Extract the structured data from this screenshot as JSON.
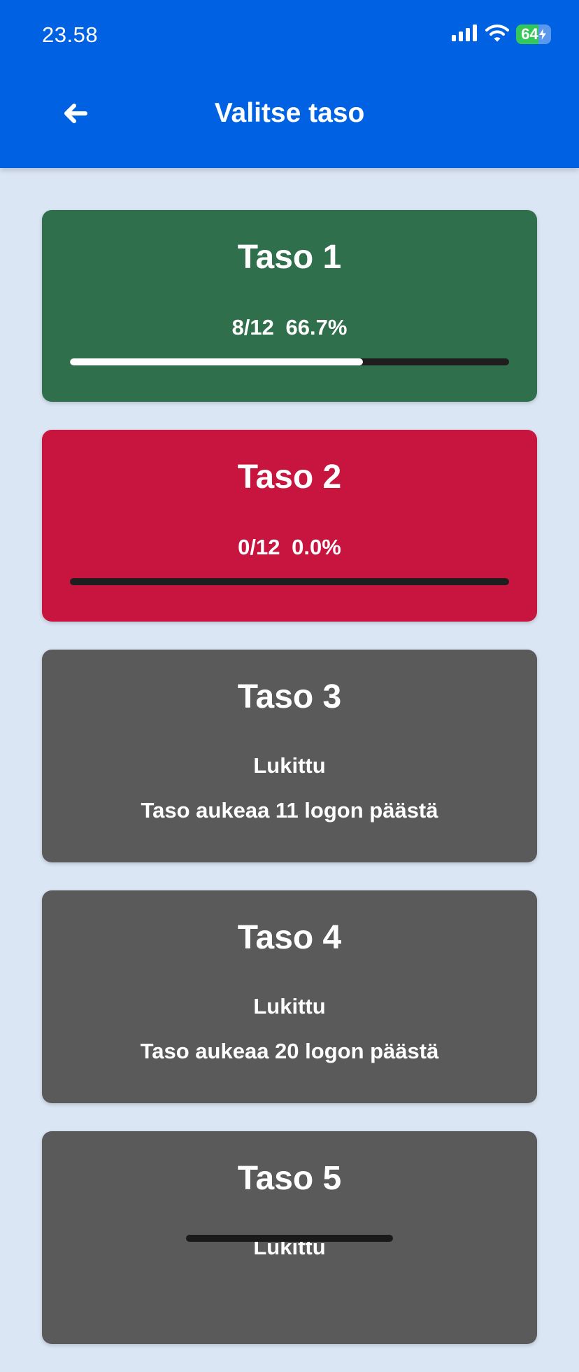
{
  "status_bar": {
    "time": "23.58",
    "battery": "64",
    "battery_level": 0.64,
    "icons": [
      "cellular-signal-icon",
      "wifi-icon",
      "battery-icon",
      "charging-bolt-icon"
    ]
  },
  "header": {
    "title": "Valitse taso",
    "back_icon": "arrow-left-icon"
  },
  "colors": {
    "header_bg": "#0062e3",
    "page_bg": "#dbe6f4",
    "level_in_progress": "#2f6f4b",
    "level_not_started": "#c8153f",
    "level_locked": "#5a5a5a",
    "progress_track": "#1e1e1e",
    "progress_fill": "#ffffff"
  },
  "levels": [
    {
      "title": "Taso 1",
      "progress_count": "8/12",
      "progress_percent": "66.7%",
      "progress_fraction": 0.667,
      "bg": "#2f6f4b"
    },
    {
      "title": "Taso 2",
      "progress_count": "0/12",
      "progress_percent": "0.0%",
      "progress_fraction": 0,
      "bg": "#c8153f"
    },
    {
      "title": "Taso 3",
      "status": "Lukittu",
      "unlock_info": "Taso aukeaa 11 logon päästä",
      "bg": "#5a5a5a"
    },
    {
      "title": "Taso 4",
      "status": "Lukittu",
      "unlock_info": "Taso aukeaa 20 logon päästä",
      "bg": "#5a5a5a"
    },
    {
      "title": "Taso 5",
      "status": "Lukittu",
      "bg": "#5a5a5a"
    }
  ]
}
